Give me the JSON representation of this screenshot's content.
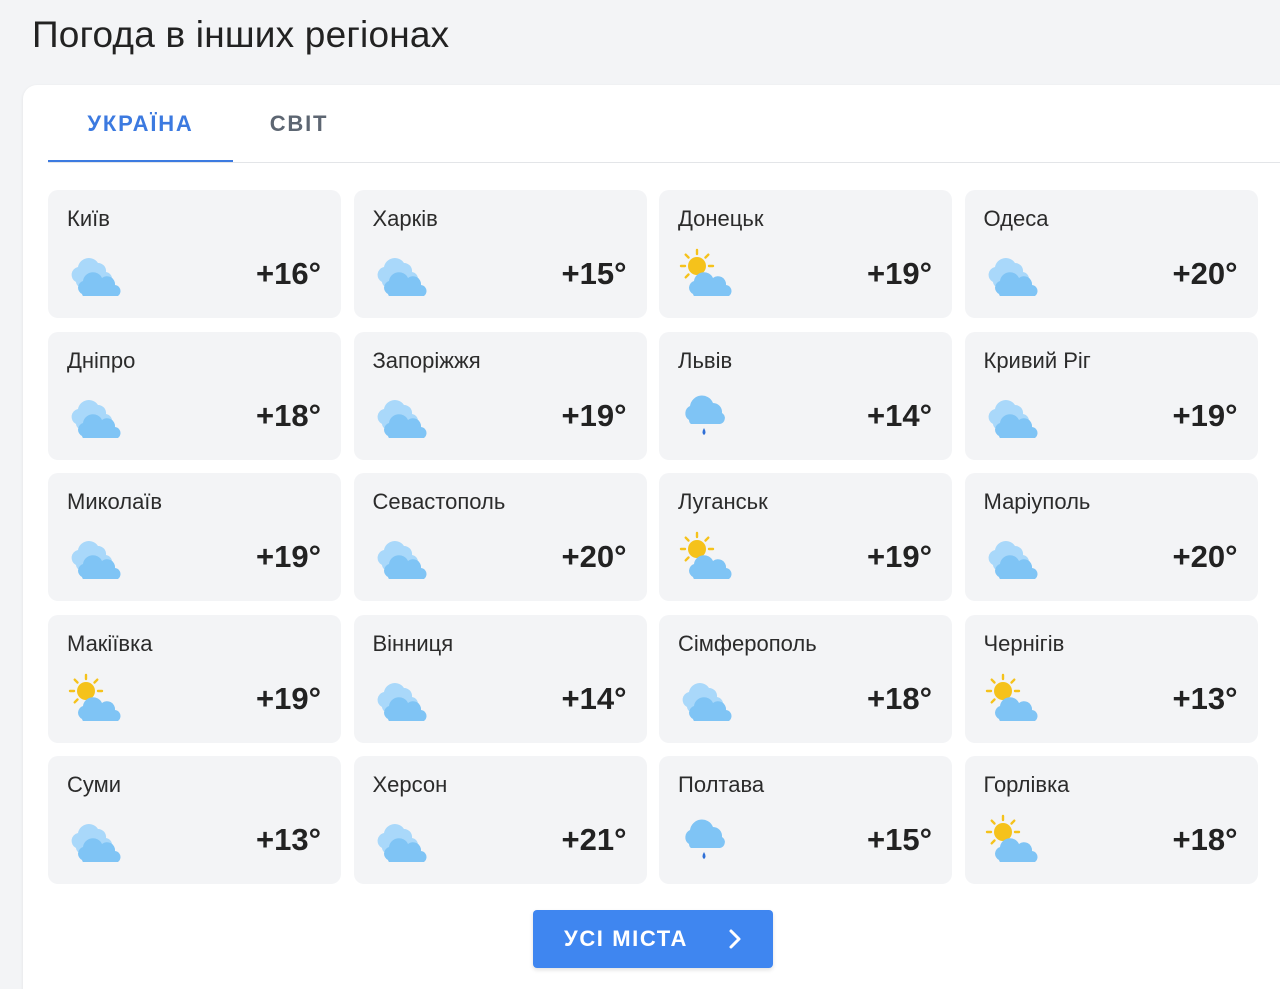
{
  "page_title": "Погода в інших регіонах",
  "tabs": [
    {
      "label": "УКРАЇНА",
      "active": true
    },
    {
      "label": "СВІТ",
      "active": false
    }
  ],
  "cities": [
    {
      "name": "Київ",
      "temp": "+16°",
      "icon": "cloudy-icon"
    },
    {
      "name": "Харків",
      "temp": "+15°",
      "icon": "cloudy-icon"
    },
    {
      "name": "Донецьк",
      "temp": "+19°",
      "icon": "partly-sunny-icon"
    },
    {
      "name": "Одеса",
      "temp": "+20°",
      "icon": "cloudy-icon"
    },
    {
      "name": "Дніпро",
      "temp": "+18°",
      "icon": "cloudy-icon"
    },
    {
      "name": "Запоріжжя",
      "temp": "+19°",
      "icon": "cloudy-icon"
    },
    {
      "name": "Львів",
      "temp": "+14°",
      "icon": "rain-icon"
    },
    {
      "name": "Кривий Ріг",
      "temp": "+19°",
      "icon": "cloudy-icon"
    },
    {
      "name": "Миколаїв",
      "temp": "+19°",
      "icon": "cloudy-icon"
    },
    {
      "name": "Севастополь",
      "temp": "+20°",
      "icon": "cloudy-icon"
    },
    {
      "name": "Луганськ",
      "temp": "+19°",
      "icon": "partly-sunny-icon"
    },
    {
      "name": "Маріуполь",
      "temp": "+20°",
      "icon": "cloudy-icon"
    },
    {
      "name": "Макіївка",
      "temp": "+19°",
      "icon": "partly-sunny-icon"
    },
    {
      "name": "Вінниця",
      "temp": "+14°",
      "icon": "cloudy-icon"
    },
    {
      "name": "Сімферополь",
      "temp": "+18°",
      "icon": "cloudy-icon"
    },
    {
      "name": "Чернігів",
      "temp": "+13°",
      "icon": "partly-sunny-icon"
    },
    {
      "name": "Суми",
      "temp": "+13°",
      "icon": "cloudy-icon"
    },
    {
      "name": "Херсон",
      "temp": "+21°",
      "icon": "cloudy-icon"
    },
    {
      "name": "Полтава",
      "temp": "+15°",
      "icon": "rain-icon"
    },
    {
      "name": "Горлівка",
      "temp": "+18°",
      "icon": "partly-sunny-icon"
    }
  ],
  "all_cities_button": {
    "label": "УСІ МІСТА",
    "icon": "chevron-right-icon"
  },
  "colors": {
    "accent": "#3c7ae0",
    "button": "#3f86f0",
    "card_bg": "#f3f4f6",
    "cloud": "#7fc4f5",
    "sun": "#f5c21b",
    "rain_drop": "#2f6fd6"
  }
}
